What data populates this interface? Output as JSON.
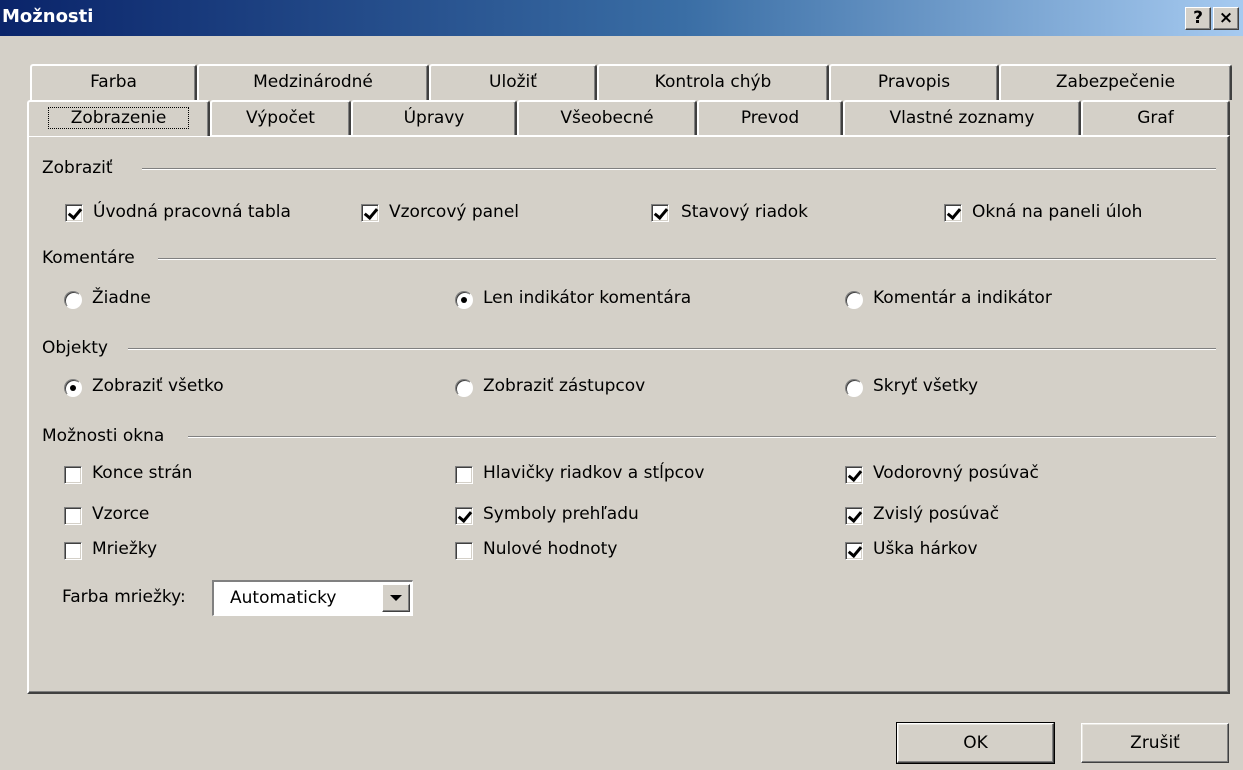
{
  "window": {
    "title": "Možnosti",
    "help_button": "?",
    "close_button": "×"
  },
  "tabs_back": [
    "Farba",
    "Medzinárodné",
    "Uložiť",
    "Kontrola chýb",
    "Pravopis",
    "Zabezpečenie"
  ],
  "tabs_front": [
    "Zobrazenie",
    "Výpočet",
    "Úpravy",
    "Všeobecné",
    "Prevod",
    "Vlastné zoznamy",
    "Graf"
  ],
  "active_tab": "Zobrazenie",
  "groups": {
    "zobrazit": {
      "label": "Zobraziť",
      "checkboxes": [
        {
          "label": "Úvodná pracovná tabla",
          "checked": true
        },
        {
          "label": "Vzorcový panel",
          "checked": true
        },
        {
          "label": "Stavový riadok",
          "checked": true
        },
        {
          "label": "Okná na paneli úloh",
          "checked": true
        }
      ]
    },
    "komentare": {
      "label": "Komentáre",
      "radios": [
        {
          "label": "Žiadne",
          "checked": false
        },
        {
          "label": "Len indikátor komentára",
          "checked": true
        },
        {
          "label": "Komentár a indikátor",
          "checked": false
        }
      ]
    },
    "objekty": {
      "label": "Objekty",
      "radios": [
        {
          "label": "Zobraziť všetko",
          "checked": true
        },
        {
          "label": "Zobraziť zástupcov",
          "checked": false
        },
        {
          "label": "Skryť všetky",
          "checked": false
        }
      ]
    },
    "moznosti_okna": {
      "label": "Možnosti okna",
      "checkboxes": [
        {
          "label": "Konce strán",
          "checked": false
        },
        {
          "label": "Vzorce",
          "checked": false
        },
        {
          "label": "Mriežky",
          "checked": false
        },
        {
          "label": "Hlavičky riadkov a stĺpcov",
          "checked": false
        },
        {
          "label": "Symboly prehľadu",
          "checked": true
        },
        {
          "label": "Nulové hodnoty",
          "checked": false
        },
        {
          "label": "Vodorovný posúvač",
          "checked": true
        },
        {
          "label": "Zvislý posúvač",
          "checked": true
        },
        {
          "label": "Uška hárkov",
          "checked": true
        }
      ],
      "gridcolor_label": "Farba mriežky:",
      "gridcolor_value": "Automaticky"
    }
  },
  "buttons": {
    "ok": "OK",
    "cancel": "Zrušiť"
  }
}
